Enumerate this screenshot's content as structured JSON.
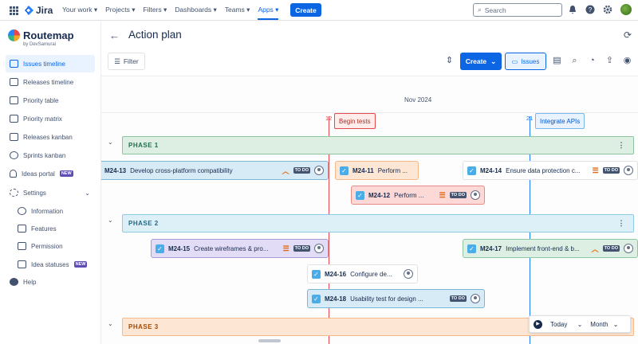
{
  "topnav": {
    "app": "Jira",
    "items": [
      "Your work",
      "Projects",
      "Filters",
      "Dashboards",
      "Teams",
      "Apps"
    ],
    "active": "Apps",
    "create": "Create",
    "search_placeholder": "Search"
  },
  "sidebar": {
    "brand": "Routemap",
    "by": "by DevSamurai",
    "items": [
      {
        "label": "Issues timeline",
        "active": true
      },
      {
        "label": "Releases timeline"
      },
      {
        "label": "Priority table"
      },
      {
        "label": "Priority matrix"
      },
      {
        "label": "Releases kanban"
      },
      {
        "label": "Sprints kanban"
      },
      {
        "label": "Ideas portal",
        "badge": "NEW"
      },
      {
        "label": "Settings"
      }
    ],
    "settings_sub": [
      {
        "label": "Information"
      },
      {
        "label": "Features"
      },
      {
        "label": "Permission"
      },
      {
        "label": "Idea statuses",
        "badge": "NEW"
      }
    ],
    "help": "Help"
  },
  "page": {
    "title": "Action plan"
  },
  "toolbar": {
    "filter": "Filter",
    "create": "Create",
    "issues": "Issues"
  },
  "timeline": {
    "month": "Nov 2024",
    "markers": [
      {
        "day": "12",
        "label": "Begin tests",
        "color": "#e5484d"
      },
      {
        "day": "21",
        "label": "Integrate APIs",
        "color": "#1d7afc"
      }
    ],
    "phases": [
      {
        "label": "PHASE 1"
      },
      {
        "label": "PHASE 2"
      },
      {
        "label": "PHASE 3"
      }
    ],
    "tasks": [
      {
        "key": "M24-13",
        "title": "Develop cross-platform compatibility",
        "status": "TO DO",
        "priority": "high"
      },
      {
        "key": "M24-11",
        "title": "Perform ..."
      },
      {
        "key": "M24-14",
        "title": "Ensure data protection c...",
        "status": "TO DO",
        "priority": "medium"
      },
      {
        "key": "M24-12",
        "title": "Perform ...",
        "status": "TO DO",
        "priority": "medium"
      },
      {
        "key": "M24-15",
        "title": "Create wireframes & pro...",
        "status": "TO DO",
        "priority": "medium"
      },
      {
        "key": "M24-17",
        "title": "Implement front-end & b...",
        "status": "TO DO",
        "priority": "high"
      },
      {
        "key": "M24-16",
        "title": "Configure de..."
      },
      {
        "key": "M24-18",
        "title": "Usability test for design ...",
        "status": "TO DO"
      }
    ]
  },
  "controls": {
    "today": "Today",
    "zoom": "Month"
  }
}
